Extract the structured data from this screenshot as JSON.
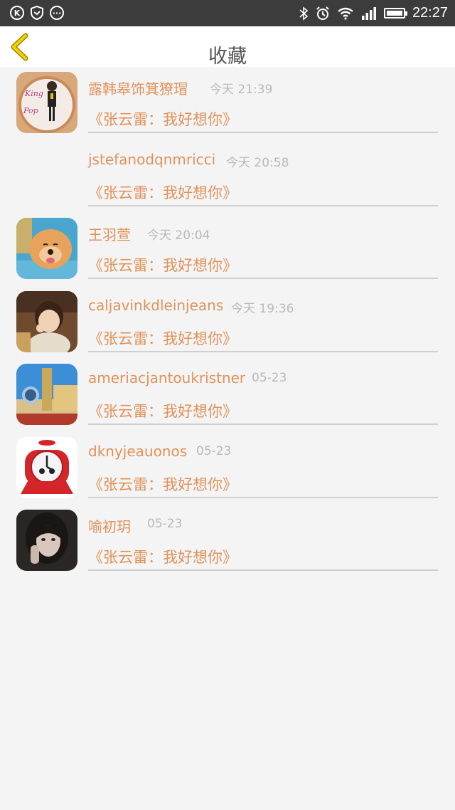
{
  "status_bar": {
    "time": "22:27",
    "left_icons": [
      "k-circle-icon",
      "shield-icon",
      "message-dots-icon"
    ],
    "right_icons": [
      "bluetooth-icon",
      "alarm-icon",
      "wifi-icon",
      "signal-icon",
      "battery-icon"
    ]
  },
  "header": {
    "title": "收藏",
    "back_icon": "chevron-left-icon"
  },
  "colors": {
    "accent": "#e0925a",
    "back_icon": "#f2d200",
    "status_bar_bg": "#3c3c3c",
    "page_bg": "#f4f4f4",
    "time_text": "#b9b9b9"
  },
  "favorites": [
    {
      "name": "露韩皋饰箕獠瑁",
      "time": "今天 21:39",
      "title": "《张云雷：我好想你》",
      "avatar": "king-of-pop-avatar"
    },
    {
      "name": "jstefanodqnmricci",
      "time": "今天 20:58",
      "title": "《张云雷：我好想你》",
      "avatar": ""
    },
    {
      "name": "王羽萱",
      "time": "今天 20:04",
      "title": "《张云雷：我好想你》",
      "avatar": "puppy-avatar"
    },
    {
      "name": "caljavinkdleinjeans",
      "time": "今天 19:36",
      "title": "《张云雷：我好想你》",
      "avatar": "child-avatar"
    },
    {
      "name": "ameriacjantoukristner",
      "time": "05-23",
      "title": "《张云雷：我好想你》",
      "avatar": "city-avatar"
    },
    {
      "name": "dknyjeauonos",
      "time": "05-23",
      "title": "《张云雷：我好想你》",
      "avatar": "alarm-clock-avatar"
    },
    {
      "name": "喻初玥",
      "time": "05-23",
      "title": "《张云雷：我好想你》",
      "avatar": "girl-avatar"
    }
  ]
}
